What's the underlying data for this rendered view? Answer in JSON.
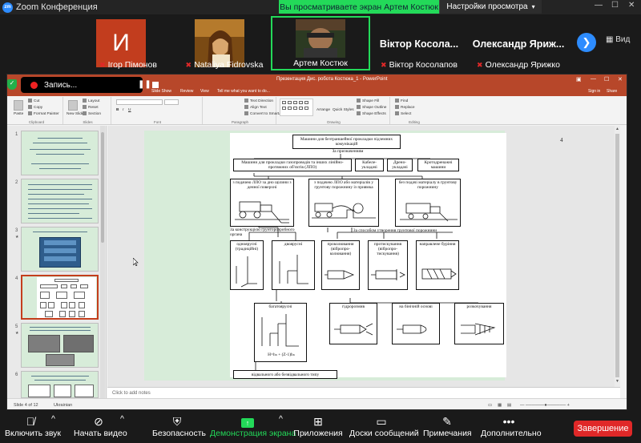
{
  "app": {
    "title": "Zoom Конференция",
    "logo": "zm",
    "share_banner": "Вы просматриваете экран Артем Костюк",
    "view_options": "Настройки просмотра",
    "accent": "#2d8cff",
    "share_color": "#23d959",
    "end_color": "#e02828"
  },
  "participants": [
    {
      "name": "Ігор Пімонов",
      "initial": "И",
      "muted": true
    },
    {
      "name": "Nataliya Fidrovska",
      "muted": true
    },
    {
      "name": "Артем Костюк",
      "muted": false,
      "active": true
    },
    {
      "name": "Віктор Косолапов",
      "label": "Віктор  Косола...",
      "muted": true
    },
    {
      "name": "Олександр Ярижко",
      "label": "Олександр  Яриж...",
      "muted": true
    }
  ],
  "gallery": {
    "next_icon": "chevron-right-icon",
    "view_label": "Вид"
  },
  "recording": {
    "label": "Запись...",
    "pause_icon": "pause-icon",
    "stop_icon": "stop-icon"
  },
  "powerpoint": {
    "window_title": "Презентация Дис. робота Костюка_1 - PowerPoint",
    "tabs": [
      "Slide Show",
      "Review",
      "View",
      "Tell me what you want to do..."
    ],
    "account": [
      "Sign in",
      "Share"
    ],
    "ribbon": {
      "clipboard": {
        "label": "Clipboard",
        "paste": "Paste",
        "cut": "Cut",
        "copy": "Copy",
        "format_painter": "Format Painter"
      },
      "slides": {
        "label": "Slides",
        "new_slide": "New Slide",
        "layout": "Layout",
        "reset": "Reset",
        "section": "Section"
      },
      "font": {
        "label": "Font"
      },
      "paragraph": {
        "label": "Paragraph",
        "text_direction": "Text Direction",
        "align_text": "Align Text",
        "convert": "Convert to SmartArt"
      },
      "drawing": {
        "label": "Drawing",
        "arrange": "Arrange",
        "quick_styles": "Quick Styles",
        "shape_fill": "Shape Fill",
        "shape_outline": "Shape Outline",
        "shape_effects": "Shape Effects"
      },
      "editing": {
        "label": "Editing",
        "find": "Find",
        "replace": "Replace",
        "select": "Select"
      }
    },
    "thumbnail_numbers": [
      "1",
      "2",
      "3",
      "4",
      "5",
      "6"
    ],
    "active_slide": 4,
    "notes_placeholder": "Click to add notes",
    "status": {
      "slide": "Slide 4 of 12",
      "language": "Ukrainian"
    },
    "slide": {
      "page_number": "4",
      "root": "Машини для безтраншейної прокладки підземних комунікацій",
      "by_purpose": "За призначенням",
      "purpose_types": [
        "Машини для прокладки газопроводів та інших лінійно-протяжних об'єктів (ЛПО)",
        "Кабеле-укладачі",
        "Дрено-укладачі",
        "Кротодренажні машини"
      ],
      "delivery_types": [
        "з подачею ЛПО за дно щілини з денної поверхні",
        "з подачею ЛПО або матеріалів у грунтову порожнину із приямка",
        "без подачі матеріалу в грунтову порожнину"
      ],
      "by_design": "За конструкцією грунторозробного органа",
      "by_cavity": "За способом утворення грунтової порожнини",
      "design_types": [
        "одноярусні (традиційні)",
        "двоярусні",
        "багатоярусні"
      ],
      "cavity_types": [
        "проколювання (вібропро-колювання)",
        "протискування (вібропро-тискування)",
        "направлене буріння",
        "гідророзмив",
        "на бінічній основі",
        "розкочування"
      ],
      "formula": "H=hₙ + (Z-1)hₙ",
      "bottom": "відвального або безвідвального типу",
      "background": "#d7ecd9"
    }
  },
  "toolbar": [
    {
      "label": "Включить звук",
      "icon": "mic-off-icon",
      "caret": true
    },
    {
      "label": "Начать видео",
      "icon": "video-off-icon",
      "caret": true
    },
    {
      "label": "Безопасность",
      "icon": "shield-icon"
    },
    {
      "label": "Демонстрация экрана",
      "icon": "share-screen-icon",
      "caret": true,
      "active": true
    },
    {
      "label": "Приложения",
      "icon": "apps-icon"
    },
    {
      "label": "Доски сообщений",
      "icon": "whiteboard-icon"
    },
    {
      "label": "Примечания",
      "icon": "notes-icon"
    },
    {
      "label": "Дополнительно",
      "icon": "more-icon"
    }
  ],
  "end_button": "Завершение"
}
